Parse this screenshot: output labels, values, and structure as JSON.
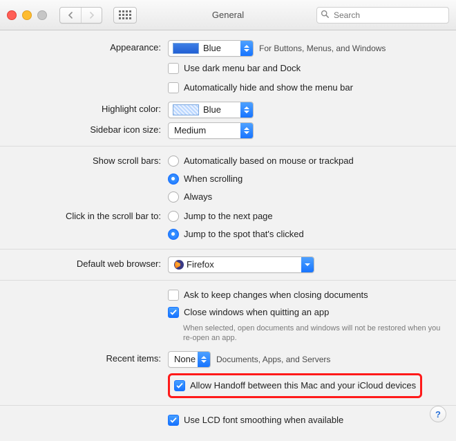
{
  "window": {
    "title": "General"
  },
  "search": {
    "placeholder": "Search"
  },
  "labels": {
    "appearance": "Appearance:",
    "highlight": "Highlight color:",
    "sidebar": "Sidebar icon size:",
    "scroll": "Show scroll bars:",
    "click": "Click in the scroll bar to:",
    "browser": "Default web browser:",
    "recent": "Recent items:"
  },
  "appearance": {
    "value": "Blue",
    "trail": "For Buttons, Menus, and Windows",
    "darkmenu": "Use dark menu bar and Dock",
    "autohide": "Automatically hide and show the menu bar"
  },
  "highlight": {
    "value": "Blue"
  },
  "sidebar": {
    "value": "Medium"
  },
  "scroll": {
    "options": [
      "Automatically based on mouse or trackpad",
      "When scrolling",
      "Always"
    ],
    "selected": 1
  },
  "click": {
    "options": [
      "Jump to the next page",
      "Jump to the spot that's clicked"
    ],
    "selected": 1
  },
  "browser": {
    "value": "Firefox"
  },
  "doc": {
    "ask": "Ask to keep changes when closing documents",
    "close": "Close windows when quitting an app",
    "note": "When selected, open documents and windows will not be restored when you re-open an app."
  },
  "recent": {
    "value": "None",
    "trail": "Documents, Apps, and Servers"
  },
  "handoff": "Allow Handoff between this Mac and your iCloud devices",
  "lcd": "Use LCD font smoothing when available",
  "help": "?"
}
